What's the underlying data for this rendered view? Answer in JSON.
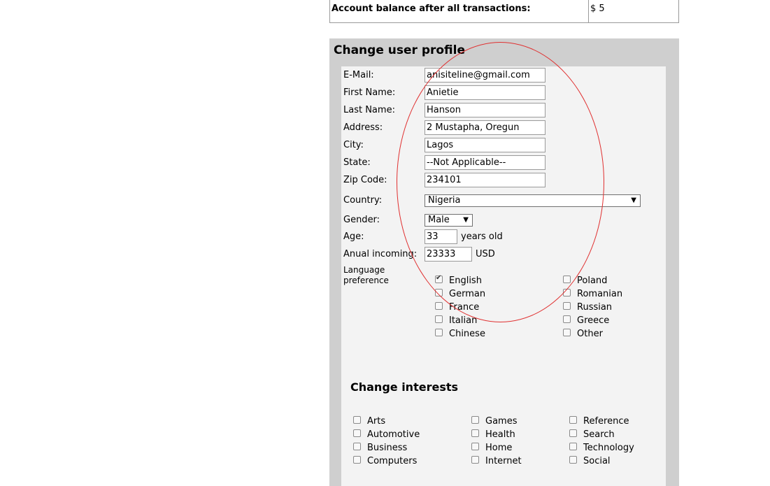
{
  "balance": {
    "label": "Account balance after all transactions:",
    "value": "$ 5"
  },
  "profile": {
    "title": "Change user profile",
    "email": {
      "label": "E-Mail:",
      "value": "anisiteline@gmail.com"
    },
    "first_name": {
      "label": "First Name:",
      "value": "Anietie"
    },
    "last_name": {
      "label": "Last Name:",
      "value": "Hanson"
    },
    "address": {
      "label": "Address:",
      "value": "2 Mustapha, Oregun"
    },
    "city": {
      "label": "City:",
      "value": "Lagos"
    },
    "state": {
      "label": "State:",
      "value": "--Not Applicable--"
    },
    "zip": {
      "label": "Zip Code:",
      "value": "234101"
    },
    "country": {
      "label": "Country:",
      "value": "Nigeria"
    },
    "gender": {
      "label": "Gender:",
      "value": "Male"
    },
    "age": {
      "label": "Age:",
      "value": "33",
      "suffix": "years old"
    },
    "income": {
      "label": "Anual incoming:",
      "value": "23333",
      "suffix": "USD"
    },
    "language": {
      "label_line1": "Language",
      "label_line2": "preference",
      "options": [
        {
          "label": "English",
          "checked": true
        },
        {
          "label": "German",
          "checked": false
        },
        {
          "label": "France",
          "checked": false
        },
        {
          "label": "Italian",
          "checked": false
        },
        {
          "label": "Chinese",
          "checked": false
        },
        {
          "label": "Poland",
          "checked": false
        },
        {
          "label": "Romanian",
          "checked": false
        },
        {
          "label": "Russian",
          "checked": false
        },
        {
          "label": "Greece",
          "checked": false
        },
        {
          "label": "Other",
          "checked": false
        }
      ]
    }
  },
  "interests": {
    "title": "Change interests",
    "options": [
      {
        "label": "Arts",
        "checked": false
      },
      {
        "label": "Automotive",
        "checked": false
      },
      {
        "label": "Business",
        "checked": false
      },
      {
        "label": "Computers",
        "checked": false
      },
      {
        "label": "Games",
        "checked": false
      },
      {
        "label": "Health",
        "checked": false
      },
      {
        "label": "Home",
        "checked": false
      },
      {
        "label": "Internet",
        "checked": false
      },
      {
        "label": "Reference",
        "checked": false
      },
      {
        "label": "Search",
        "checked": false
      },
      {
        "label": "Technology",
        "checked": false
      },
      {
        "label": "Social",
        "checked": false
      }
    ]
  },
  "colors": {
    "annotation_ellipse": "#e03030",
    "panel_bg": "#cfcfcf",
    "form_bg": "#f3f3f3"
  },
  "icons": {
    "checkbox_checked": "check-mark-icon",
    "select_arrow": "dropdown-arrow-icon"
  }
}
